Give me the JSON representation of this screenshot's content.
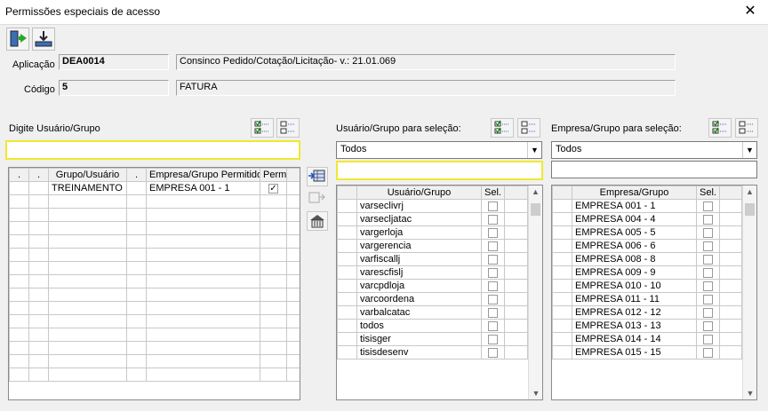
{
  "window": {
    "title": "Permissões especiais de acesso",
    "close": "✕"
  },
  "header": {
    "aplicacao_label": "Aplicação",
    "aplicacao_code": "DEA0014",
    "aplicacao_desc": "Consinco Pedido/Cotação/Licitação- v.: 21.01.069",
    "codigo_label": "Código",
    "codigo_value": "5",
    "codigo_desc": "FATURA"
  },
  "left": {
    "label": "Digite Usuário/Grupo",
    "input_value": "",
    "columns": [
      ".",
      ".",
      "Grupo/Usuário",
      ".",
      "Empresa/Grupo Permitido",
      "Perm."
    ],
    "rows": [
      {
        "user": "TREINAMENTO",
        "empresa": "EMPRESA 001 - 1",
        "perm": "✓"
      }
    ]
  },
  "middle": {
    "label": "Usuário/Grupo para seleção:",
    "combo_value": "Todos",
    "input_value": "",
    "columns": [
      "Usuário/Grupo",
      "Sel."
    ],
    "rows": [
      "varseclivrj",
      "varsecljatac",
      "vargerloja",
      "vargerencia",
      "varfiscallj",
      "varescfislj",
      "varcpdloja",
      "varcoordena",
      "varbalcatac",
      "todos",
      "tisisger",
      "tisisdesenv"
    ]
  },
  "right": {
    "label": "Empresa/Grupo para seleção:",
    "combo_value": "Todos",
    "input_value": "",
    "columns": [
      "Empresa/Grupo",
      "Sel."
    ],
    "rows": [
      "EMPRESA 001 - 1",
      "EMPRESA 004 - 4",
      "EMPRESA 005 - 5",
      "EMPRESA 006 - 6",
      "EMPRESA 008 - 8",
      "EMPRESA 009 - 9",
      "EMPRESA 010 - 10",
      "EMPRESA 011 - 11",
      "EMPRESA 012 - 12",
      "EMPRESA 013 - 13",
      "EMPRESA 014 - 14",
      "EMPRESA 015 - 15"
    ]
  },
  "icons": {
    "scroll_up": "▲",
    "scroll_down": "▼",
    "combo_arrow": "▼"
  }
}
